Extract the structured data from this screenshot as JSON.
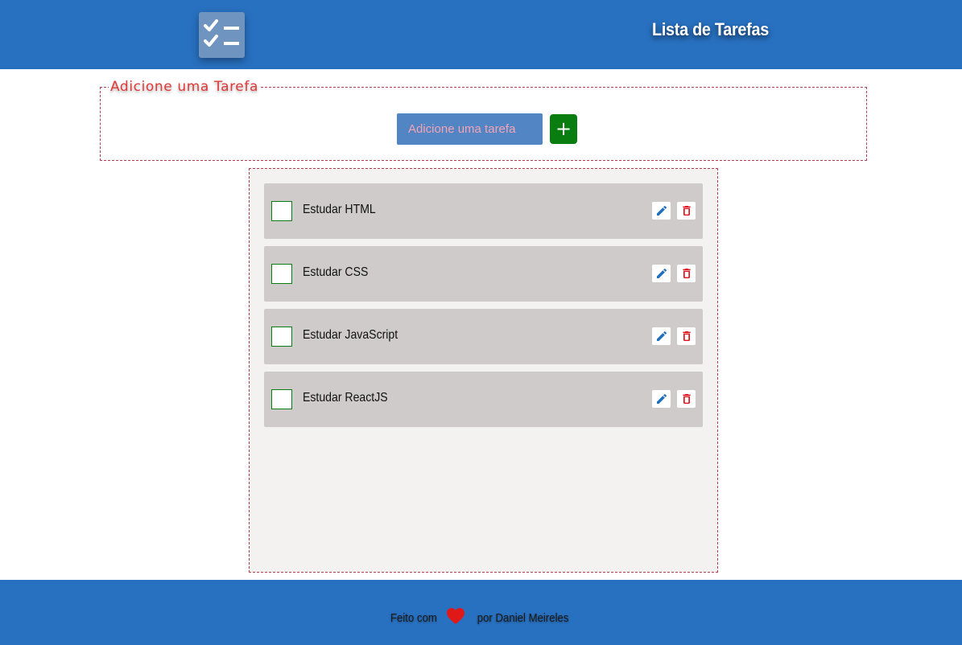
{
  "header": {
    "logo_icon": "checklist-icon",
    "title": "Lista de Tarefas"
  },
  "add_section": {
    "legend": "Adicione uma Tarefa",
    "input_placeholder": "Adicione uma tarefa",
    "input_value": "",
    "add_button_label": "+"
  },
  "tasks": [
    {
      "label": "Estudar HTML",
      "checked": false
    },
    {
      "label": "Estudar CSS",
      "checked": false
    },
    {
      "label": "Estudar JavaScript",
      "checked": false
    },
    {
      "label": "Estudar ReactJS",
      "checked": false
    }
  ],
  "footer": {
    "made_with": "Feito com",
    "heart_icon": "heart-icon",
    "by": "por Daniel Meireles"
  },
  "colors": {
    "header_bg": "#2871c1",
    "add_button": "#0a7d10",
    "edit_icon": "#1f6fc0",
    "delete_icon": "#e0121c",
    "legend_text": "#e03a3a"
  }
}
